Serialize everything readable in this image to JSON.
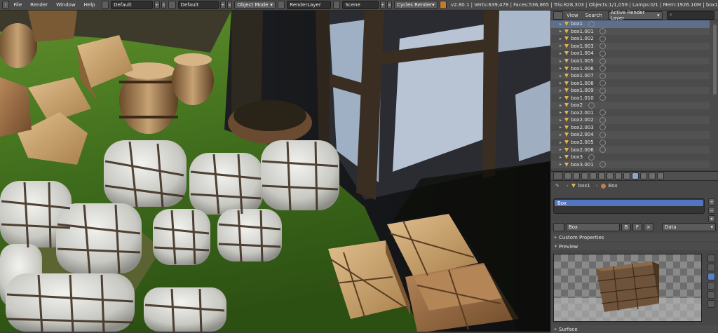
{
  "topbar": {
    "menus": [
      "File",
      "Render",
      "Window",
      "Help"
    ],
    "screen_layout": "Default",
    "scene_layout": "Default",
    "mode": "Object Mode",
    "render_layer": "RenderLayer",
    "scene": "Scene",
    "engine": "Cycles Render",
    "stats": "v2.80.1 | Verts:639,478 | Faces:536,865 | Tris:828,303 | Objects:1/1,059 | Lamps:0/1 | Mem:1926.10M | box1"
  },
  "outliner": {
    "view_label": "View",
    "search_label": "Search",
    "filter": "Active Render Layer",
    "items": [
      "box1",
      "box1.001",
      "box1.002",
      "box1.003",
      "box1.004",
      "box1.005",
      "box1.006",
      "box1.007",
      "box1.008",
      "box1.009",
      "box1.010",
      "box2",
      "box2.001",
      "box2.002",
      "box2.003",
      "box2.004",
      "box2.005",
      "box2.006",
      "box3",
      "box3.001"
    ],
    "selected": "box1"
  },
  "properties": {
    "breadcrumb_object": "box1",
    "breadcrumb_material": "Box",
    "slot_material": "Box",
    "material_name": "Box",
    "material_users_btn": "B",
    "material_fake_btn": "F",
    "link": "Data",
    "panel_custom_props": "Custom Properties",
    "panel_preview": "Preview",
    "panel_surface": "Surface"
  },
  "colors": {
    "accent": "#5375c0",
    "selection_row": "#5d6f8c",
    "object_icon": "#e0b056"
  }
}
